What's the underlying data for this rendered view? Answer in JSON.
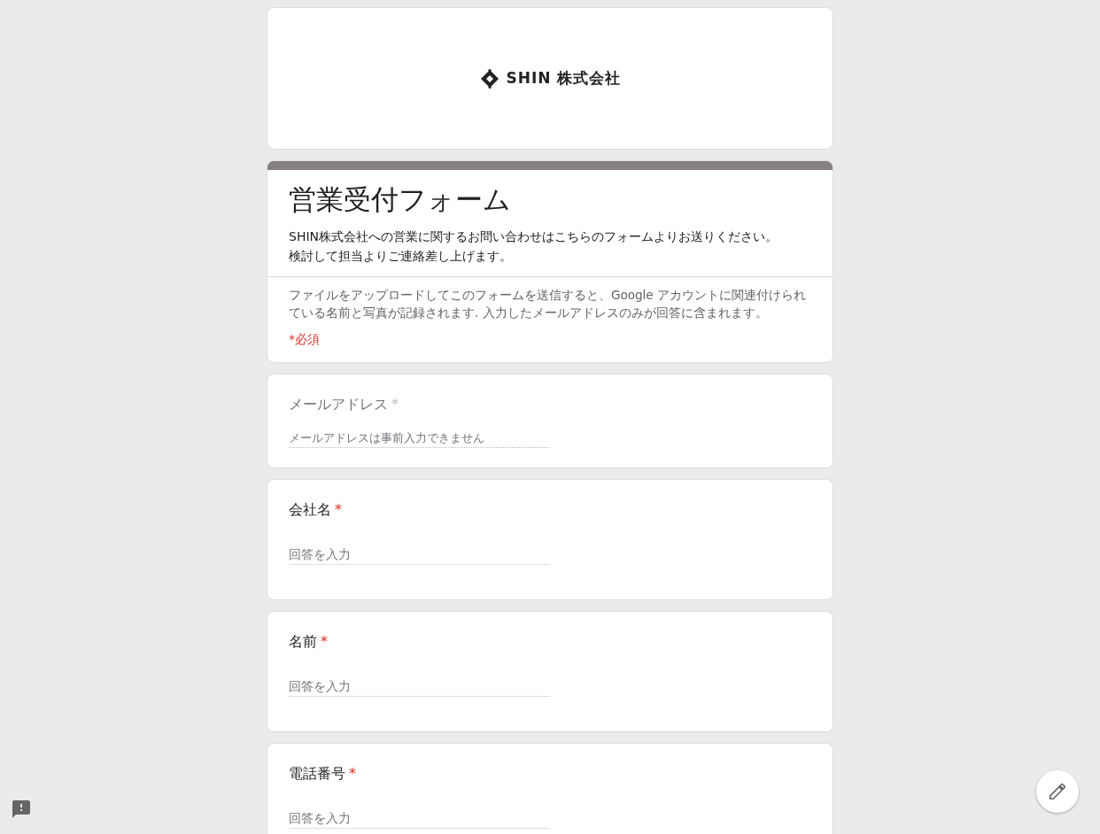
{
  "logo": {
    "text": "SHIN 株式会社"
  },
  "header": {
    "title": "営業受付フォーム",
    "description": [
      "SHIN株式会社への営業に関するお問い合わせはこちらのフォームよりお送りください。",
      "検討して担当よりご連絡差し上げます。"
    ],
    "notice": "ファイルをアップロードしてこのフォームを送信すると、Google アカウントに関連付けられている名前と写真が記録されます. 入力したメールアドレスのみが回答に含まれます。",
    "required_note": "*必須"
  },
  "questions": [
    {
      "label": "メールアドレス",
      "required_mark": "*",
      "disabled": true,
      "placeholder": "メールアドレスは事前入力できません"
    },
    {
      "label": "会社名",
      "required_mark": "*",
      "disabled": false,
      "placeholder": "回答を入力"
    },
    {
      "label": "名前",
      "required_mark": "*",
      "disabled": false,
      "placeholder": "回答を入力"
    },
    {
      "label": "電話番号",
      "required_mark": "*",
      "disabled": false,
      "placeholder": "回答を入力"
    }
  ]
}
